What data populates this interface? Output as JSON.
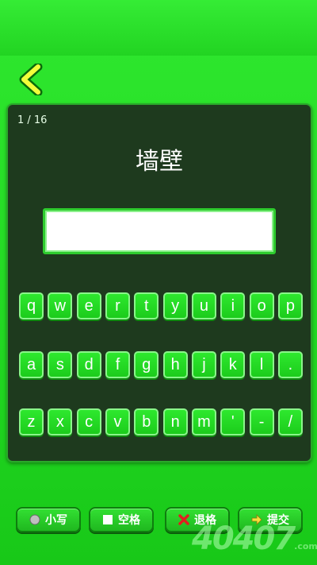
{
  "progress": {
    "counter": "1 / 16"
  },
  "prompt": {
    "word": "墙壁"
  },
  "answer": {
    "value": ""
  },
  "keyboard": {
    "rows": [
      [
        "q",
        "w",
        "e",
        "r",
        "t",
        "y",
        "u",
        "i",
        "o",
        "p"
      ],
      [
        "a",
        "s",
        "d",
        "f",
        "g",
        "h",
        "j",
        "k",
        "l",
        "."
      ],
      [
        "z",
        "x",
        "c",
        "v",
        "b",
        "n",
        "m",
        "'",
        "-",
        "/"
      ]
    ]
  },
  "bottom_bar": {
    "lowercase_label": "小写",
    "space_label": "空格",
    "backspace_label": "退格",
    "submit_label": "提交"
  },
  "watermark": {
    "text": "40407",
    "suffix": ".com"
  },
  "colors": {
    "accent": "#22d822",
    "panel": "#1e3a1e"
  }
}
